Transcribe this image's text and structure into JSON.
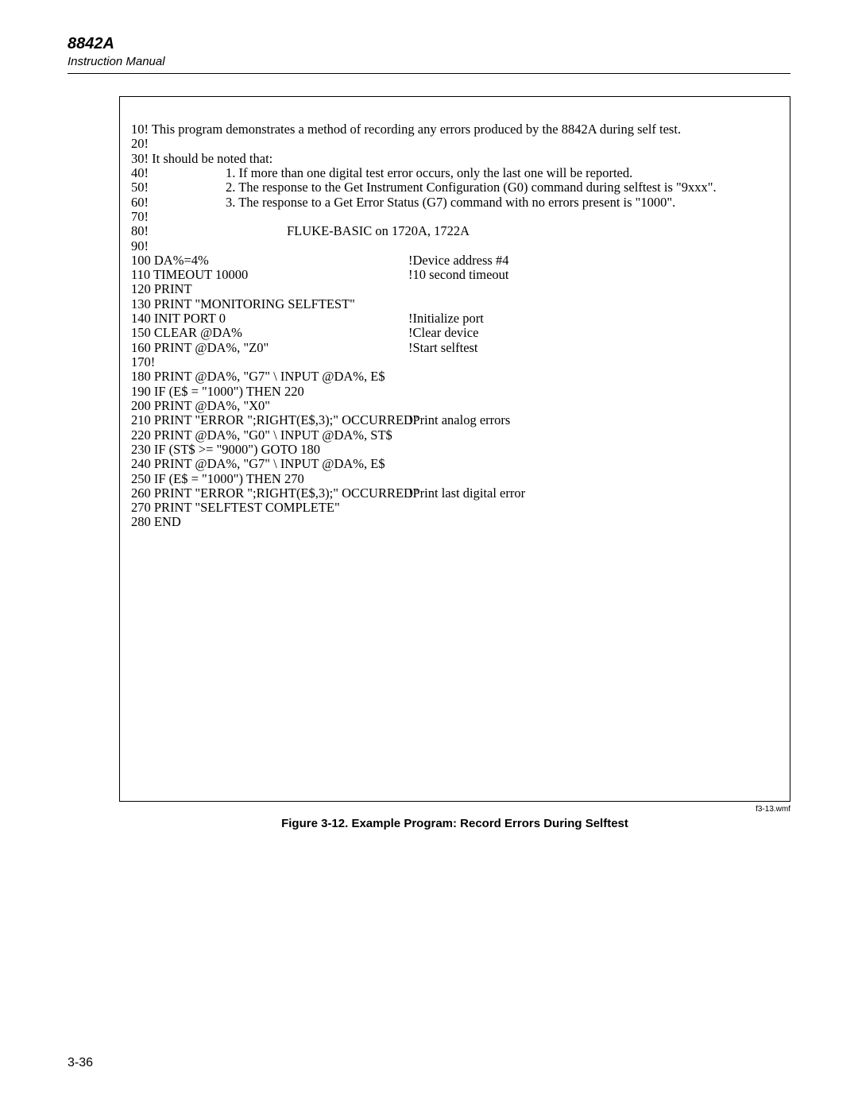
{
  "header": {
    "model": "8842A",
    "subtitle": "Instruction Manual"
  },
  "code": {
    "l10": "10! This program demonstrates a method of recording any errors produced by the 8842A during self test.",
    "l20": "20!",
    "l30": "30! It should be noted that:",
    "l40": "40!",
    "l40b": "1. If more than one digital test error occurs, only the last one will be reported.",
    "l50": "50!",
    "l50b": "2. The response to the Get Instrument Configuration (G0) command during selftest is \"9xxx\".",
    "l60": "60!",
    "l60b": "3. The response to a Get Error Status (G7) command with no errors present is \"1000\".",
    "l70": "70!",
    "l80": "80!",
    "l80b": "FLUKE-BASIC on 1720A, 1722A",
    "l90": "90!",
    "l100": "100 DA%=4%",
    "l100c": "!Device address #4",
    "l110": "110 TIMEOUT 10000",
    "l110c": "!10 second timeout",
    "l120": "120 PRINT",
    "l130": "130 PRINT \"MONITORING SELFTEST\"",
    "l140": "140 INIT PORT 0",
    "l140c": "!Initialize port",
    "l150": "150 CLEAR @DA%",
    "l150c": "!Clear device",
    "l160": "160 PRINT @DA%, \"Z0\"",
    "l160c": "!Start selftest",
    "l170": "170!",
    "l180": "180 PRINT @DA%, \"G7\" \\ INPUT @DA%, E$",
    "l190": "190 IF (E$ = \"1000\") THEN 220",
    "l200": "200 PRINT @DA%, \"X0\"",
    "l210": "210 PRINT \"ERROR \";RIGHT(E$,3);\" OCCURRED\"",
    "l210c": "!Print analog errors",
    "l220": "220 PRINT @DA%, \"G0\" \\ INPUT @DA%, ST$",
    "l230": "230 IF (ST$ >= \"9000\") GOTO 180",
    "l240": "240 PRINT @DA%, \"G7\" \\ INPUT @DA%, E$",
    "l250": "250 IF (E$ = \"1000\") THEN 270",
    "l260": "260 PRINT \"ERROR \";RIGHT(E$,3);\" OCCURRED\"",
    "l260c": "!Print last digital error",
    "l270": "270 PRINT \"SELFTEST COMPLETE\"",
    "l280": "280 END"
  },
  "wmf": "f3-13.wmf",
  "caption": "Figure 3-12. Example Program: Record Errors During Selftest",
  "page_number": "3-36"
}
